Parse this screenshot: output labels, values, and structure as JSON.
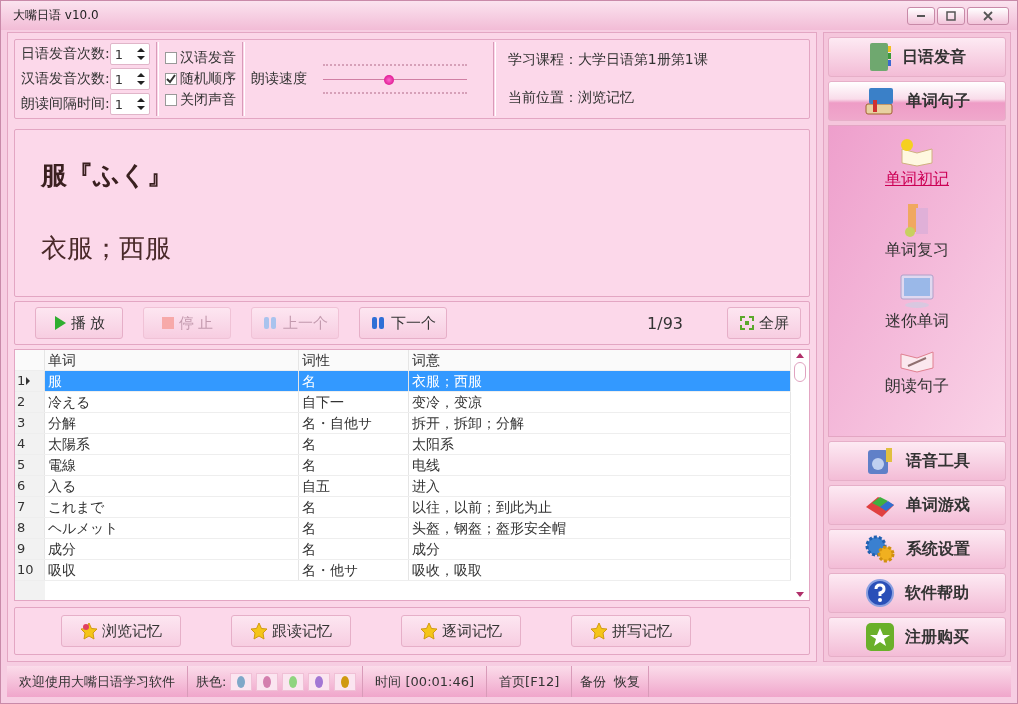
{
  "window": {
    "title": "大嘴日语 v10.0"
  },
  "settings": {
    "spinners": [
      {
        "label": "日语发音次数:",
        "value": "1"
      },
      {
        "label": "汉语发音次数:",
        "value": "1"
      },
      {
        "label": "朗读间隔时间:",
        "value": "1"
      }
    ],
    "checkboxes": [
      {
        "label": "汉语发音",
        "checked": false
      },
      {
        "label": "随机顺序",
        "checked": true
      },
      {
        "label": "关闭声音",
        "checked": false
      }
    ],
    "speed": {
      "label": "朗读速度",
      "level": 0.46
    },
    "info": [
      "学习课程：大学日语第1册第1课",
      "当前位置：浏览记忆"
    ]
  },
  "card": {
    "word": "服『ふく』",
    "meaning": "衣服；西服"
  },
  "player": {
    "buttons": [
      {
        "label": "播 放",
        "kind": "play",
        "disabled": false
      },
      {
        "label": "停 止",
        "kind": "stop",
        "disabled": true
      },
      {
        "label": "上一个",
        "kind": "prev",
        "disabled": true
      },
      {
        "label": "下一个",
        "kind": "next",
        "disabled": false
      }
    ],
    "counter": "1/93",
    "fullscreen": "全屏"
  },
  "table": {
    "columns": [
      "单词",
      "词性",
      "词意"
    ],
    "rows": [
      {
        "index": "1",
        "cells": [
          "服",
          "名",
          "衣服；西服"
        ],
        "selected": true
      },
      {
        "index": "2",
        "cells": [
          "冷える",
          "自下一",
          "变冷，变凉"
        ],
        "selected": false
      },
      {
        "index": "3",
        "cells": [
          "分解",
          "名・自他サ",
          "拆开，拆卸；分解"
        ],
        "selected": false
      },
      {
        "index": "4",
        "cells": [
          "太陽系",
          "名",
          "太阳系"
        ],
        "selected": false
      },
      {
        "index": "5",
        "cells": [
          "電線",
          "名",
          "电线"
        ],
        "selected": false
      },
      {
        "index": "6",
        "cells": [
          "入る",
          "自五",
          "进入"
        ],
        "selected": false
      },
      {
        "index": "7",
        "cells": [
          "これまで",
          "名",
          "以往，以前；到此为止"
        ],
        "selected": false
      },
      {
        "index": "8",
        "cells": [
          "ヘルメット",
          "名",
          "头盔，钢盔；盔形安全帽"
        ],
        "selected": false
      },
      {
        "index": "9",
        "cells": [
          "成分",
          "名",
          "成分"
        ],
        "selected": false
      },
      {
        "index": "10",
        "cells": [
          "吸収",
          "名・他サ",
          "吸收，吸取"
        ],
        "selected": false
      }
    ]
  },
  "modes": [
    "浏览记忆",
    "跟读记忆",
    "逐词记忆",
    "拼写记忆"
  ],
  "sidebar": {
    "top": [
      {
        "label": "日语发音",
        "kind": "notebook",
        "selected": false
      },
      {
        "label": "单词句子",
        "kind": "books",
        "selected": true
      }
    ],
    "items": [
      {
        "label": "单词初记",
        "kind": "idea",
        "selected": true
      },
      {
        "label": "单词复习",
        "kind": "review",
        "selected": false
      },
      {
        "label": "迷你单词",
        "kind": "monitor",
        "selected": false
      },
      {
        "label": "朗读句子",
        "kind": "pen",
        "selected": false
      }
    ],
    "bottom": [
      {
        "label": "语音工具",
        "kind": "tools"
      },
      {
        "label": "单词游戏",
        "kind": "game"
      },
      {
        "label": "系统设置",
        "kind": "gear"
      },
      {
        "label": "软件帮助",
        "kind": "help"
      },
      {
        "label": "注册购买",
        "kind": "star"
      }
    ]
  },
  "status_bar": {
    "welcome": "欢迎使用大嘴日语学习软件",
    "skin_label": "肤色:",
    "skins": [
      {
        "color": "#7fa8c8"
      },
      {
        "color": "#d47fae"
      },
      {
        "color": "#8fd47f"
      },
      {
        "color": "#a277d4"
      },
      {
        "color": "#d09a10"
      }
    ],
    "time": "时间 [00:01:46]",
    "home": "首页[F12]",
    "links": [
      "备份",
      "恢复"
    ]
  }
}
